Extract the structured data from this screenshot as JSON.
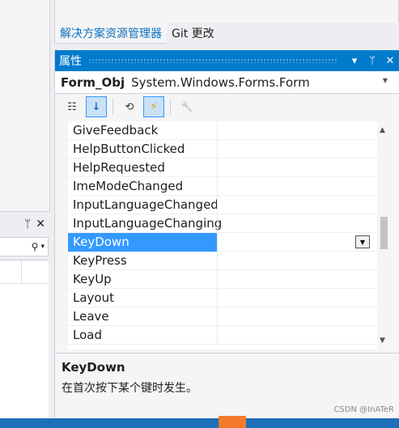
{
  "tabs": [
    {
      "label": "解决方案资源管理器",
      "active": true
    },
    {
      "label": "Git 更改",
      "active": false
    }
  ],
  "left_panel": {
    "pin_glyph": "ᛘ",
    "close_glyph": "✕",
    "search_icon_glyph": "⚲",
    "dropdown_glyph": "▾"
  },
  "properties": {
    "title": "属性",
    "title_controls": {
      "dropdown": "▾",
      "pin": "ᛘ",
      "close": "✕"
    },
    "object": {
      "name": "Form_Obj",
      "type": "System.Windows.Forms.Form"
    },
    "toolbar": [
      {
        "icon": "categorized-icon",
        "glyph": "☷",
        "on": false
      },
      {
        "icon": "alphabetical-icon",
        "glyph": "↓",
        "on": true
      },
      {
        "icon": "properties-icon",
        "glyph": "⟲",
        "on": false
      },
      {
        "icon": "events-icon",
        "glyph": "⚡",
        "on": true
      },
      {
        "icon": "property-pages-icon",
        "glyph": "🔧",
        "on": false
      }
    ],
    "events": [
      "GiveFeedback",
      "HelpButtonClicked",
      "HelpRequested",
      "ImeModeChanged",
      "InputLanguageChanged",
      "InputLanguageChanging",
      "KeyDown",
      "KeyPress",
      "KeyUp",
      "Layout",
      "Leave",
      "Load"
    ],
    "selected_event": "KeyDown",
    "description": {
      "title": "KeyDown",
      "text": "在首次按下某个键时发生。"
    }
  },
  "watermark": "CSDN @InATeR",
  "colors": {
    "accent": "#007acc",
    "selection": "#3399ff"
  }
}
